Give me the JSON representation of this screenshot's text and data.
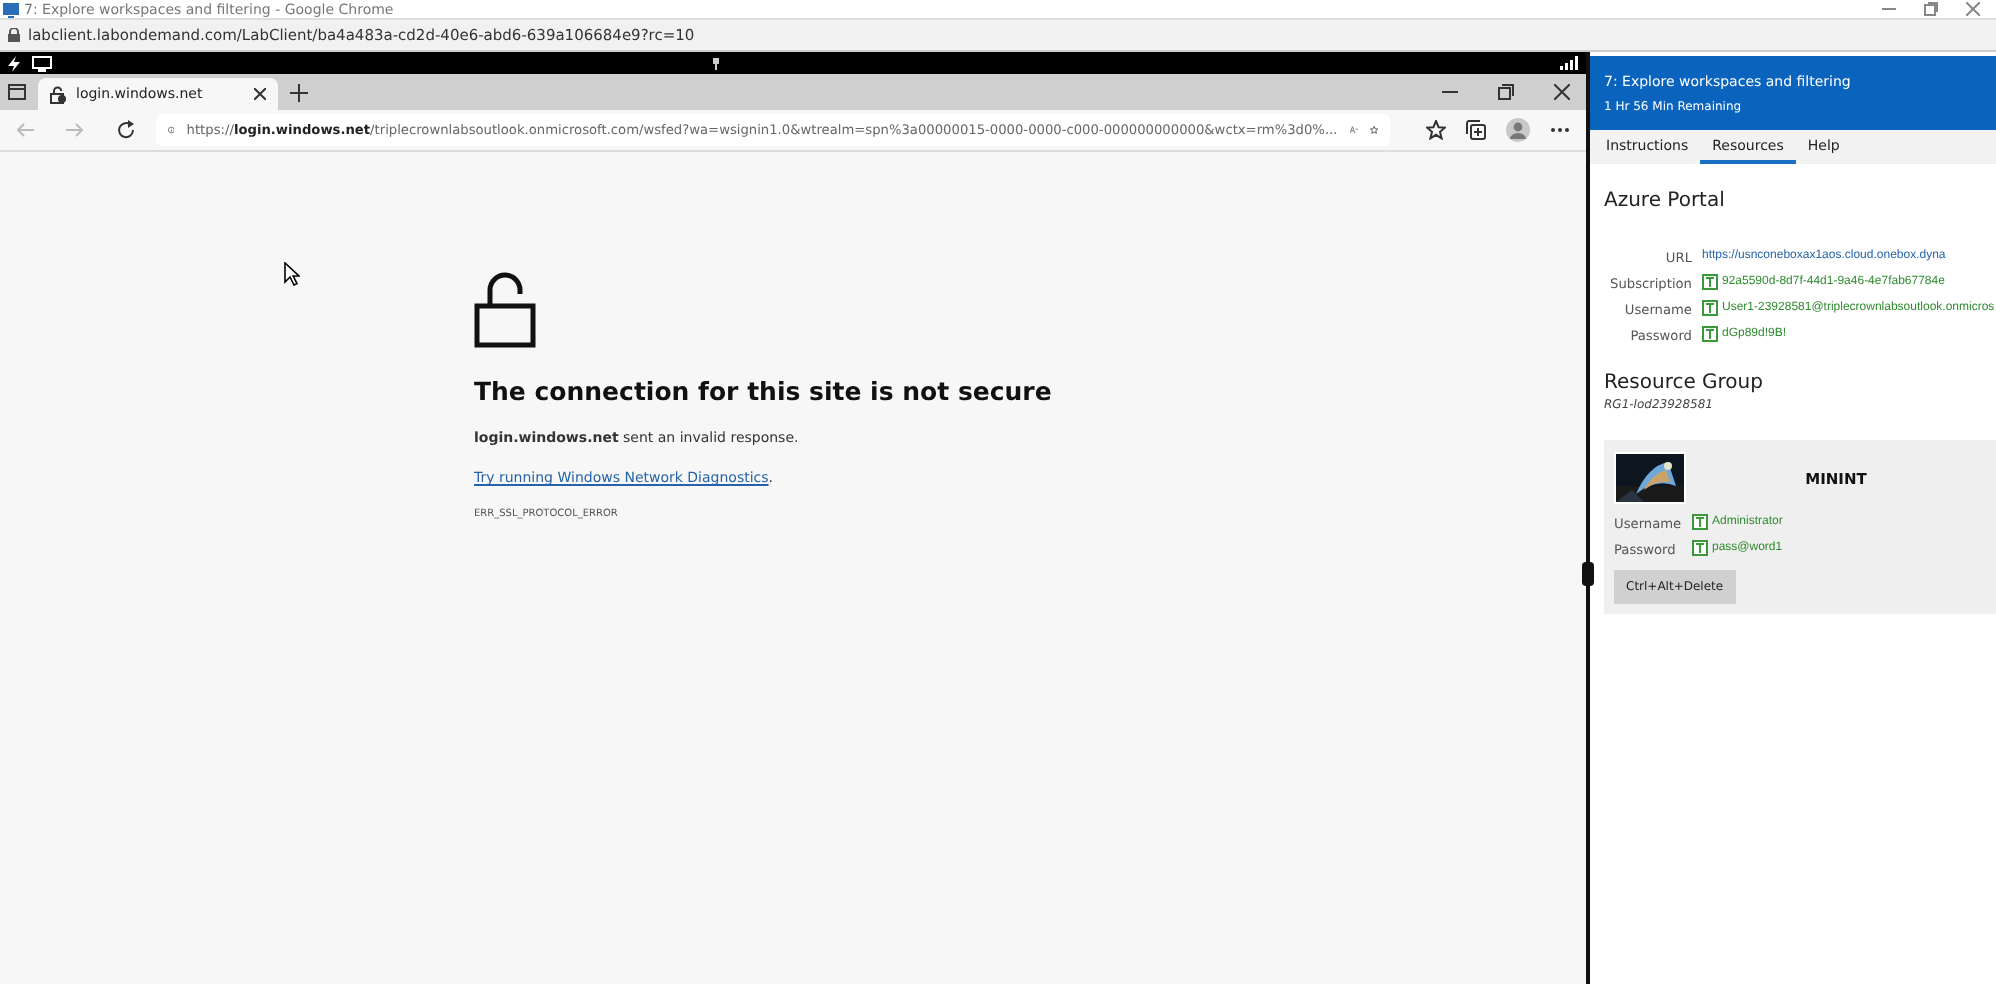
{
  "outer_window": {
    "title": "7: Explore workspaces and filtering - Google Chrome",
    "address": "labclient.labondemand.com/LabClient/ba4a483a-cd2d-40e6-abd6-639a106684e9?rc=10"
  },
  "browser": {
    "tabs": [
      {
        "label": "login.windows.net",
        "selected": true
      }
    ],
    "url": "https://**login.windows.net**/triplecrownlabsoutlook.onmicrosoft.com/wsfed?wa=wsignin1.0&wtrealm=spn%3a00000015-0000-0000-c000-000000000000&wctx=rm%3d0%..."
  },
  "error_page": {
    "heading": "The connection for this site is not secure",
    "message": "**login.windows.net** sent an invalid response.",
    "link": "Try running Windows Network Diagnostics",
    "link_suffix": ".",
    "code": "ERR_SSL_PROTOCOL_ERROR"
  },
  "lab_panel": {
    "title": "7: Explore workspaces and filtering",
    "time_remaining": "1 Hr 56 Min Remaining",
    "tabs": [
      {
        "label": "Instructions",
        "selected": false
      },
      {
        "label": "Resources",
        "selected": true
      },
      {
        "label": "Help",
        "selected": false
      }
    ],
    "azure_portal": {
      "heading": "Azure Portal",
      "fields": [
        {
          "label": "URL",
          "value": "https://usnconeboxax1aos.cloud.onebox.dyna",
          "kind": "link"
        },
        {
          "label": "Subscription",
          "value": "92a5590d-8d7f-44d1-9a46-4e7fab67784e",
          "kind": "copy"
        },
        {
          "label": "Username",
          "value": "User1-23928581@triplecrownlabsoutlook.onmicros",
          "kind": "copy"
        },
        {
          "label": "Password",
          "value": "dGp89d!9B!",
          "kind": "copy"
        }
      ]
    },
    "resource_group": {
      "heading": "Resource Group",
      "name": "RG1-lod23928581"
    },
    "machine": {
      "name": "MININT",
      "fields": [
        {
          "label": "Username",
          "value": "Administrator",
          "kind": "copy"
        },
        {
          "label": "Password",
          "value": "pass@word1",
          "kind": "copy"
        }
      ],
      "button": "Ctrl+Alt+Delete"
    }
  }
}
